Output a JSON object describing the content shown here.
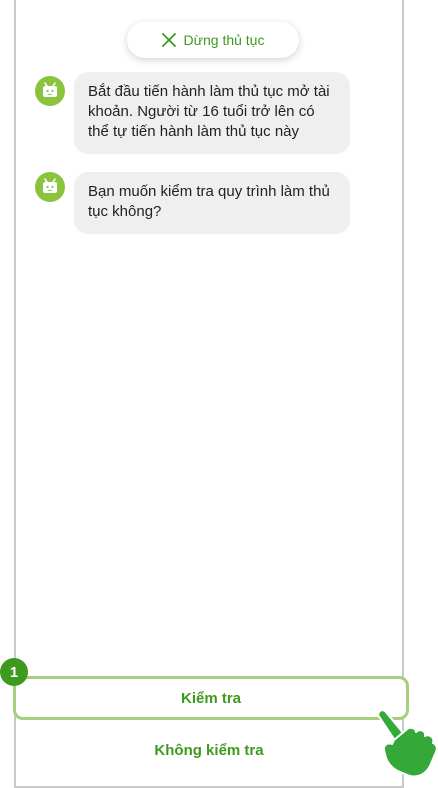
{
  "header": {
    "stop_label": "Dừng thủ tục",
    "stop_icon": "close-icon"
  },
  "messages": [
    {
      "text": "Bắt đầu tiến hành làm thủ tục mở tài khoản. Người từ 16 tuổi trở lên có thể tự tiến hành làm thủ tục này",
      "avatar_icon": "bot-icon"
    },
    {
      "text": "Bạn muốn kiểm tra quy trình làm thủ tục không?",
      "avatar_icon": "bot-icon"
    }
  ],
  "actions": {
    "check_label": "Kiểm tra",
    "no_check_label": "Không kiểm tra"
  },
  "annotation": {
    "step_number": "1",
    "pointer_icon": "hand-pointer-icon"
  },
  "colors": {
    "accent": "#3e9a1e",
    "avatar": "#8ac43f",
    "highlight": "#a5cf7c",
    "bubble": "#efefef"
  }
}
